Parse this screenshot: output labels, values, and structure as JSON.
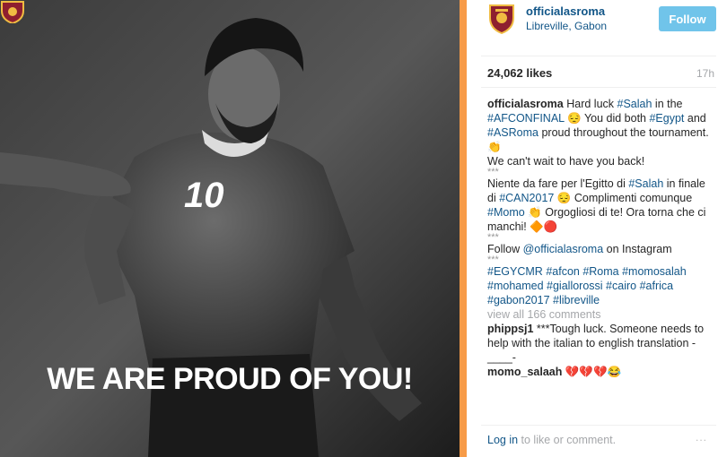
{
  "post": {
    "headline": "WE ARE PROUD OF YOU!",
    "username": "officialasroma",
    "location": "Libreville, Gabon",
    "follow_label": "Follow",
    "likes": "24,062 likes",
    "time": "17h",
    "shirt_number": "10"
  },
  "caption": {
    "p1": [
      "officialasroma",
      " Hard luck ",
      "#Salah",
      " in the ",
      "#AFCONFINAL",
      " 😔 You did both ",
      "#Egypt",
      " and ",
      "#ASRoma",
      " proud throughout the tournament. 👏"
    ],
    "p2": "We can't wait to have you back!",
    "dots": "***",
    "p3": [
      "Niente da fare per l'Egitto di ",
      "#Salah",
      " in finale di ",
      "#CAN2017",
      " 😔 Complimenti comunque ",
      "#Momo",
      " 👏 Orgogliosi di te! Ora torna che ci manchi! 🔶🔴"
    ],
    "p4": [
      "Follow ",
      "@officialasroma",
      " on Instagram"
    ],
    "tags": [
      "#EGYCMR",
      "#afcon",
      "#Roma",
      "#momosalah",
      "#mohamed",
      "#giallorossi",
      "#cairo",
      "#africa",
      "#gabon2017",
      "#libreville"
    ],
    "view_all": "view all 166 comments"
  },
  "comments": [
    {
      "user": "phippsj1",
      "text": " ***Tough luck. Someone needs to help with the italian to english translation -____-"
    },
    {
      "user": "momo_salaah",
      "text": " 💔💔💔😂"
    }
  ],
  "footer": {
    "login": "Log in",
    "rest": " to like or comment.",
    "more": "..."
  },
  "colors": {
    "accent_orange": "#f79b48",
    "link_blue": "#125688",
    "follow_button": "#70c4ea",
    "muted_gray": "#a5a7aa"
  }
}
